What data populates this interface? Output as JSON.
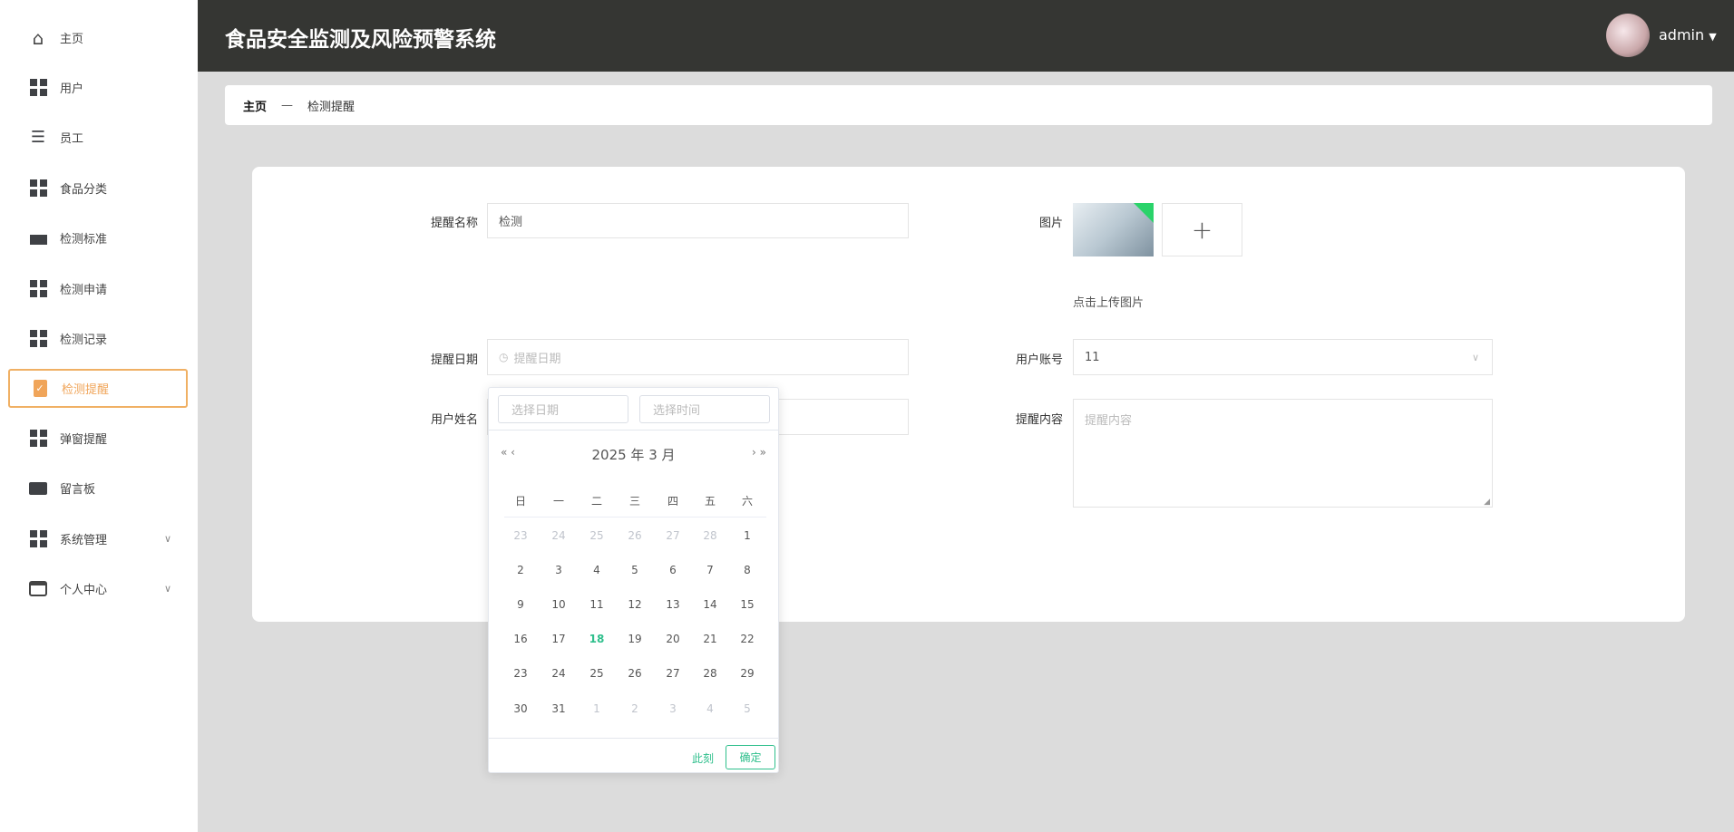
{
  "sidebar": {
    "items": [
      {
        "label": "主页",
        "icon": "home-icon"
      },
      {
        "label": "用户",
        "icon": "grid-icon"
      },
      {
        "label": "员工",
        "icon": "list-indent-icon"
      },
      {
        "label": "食品分类",
        "icon": "grid-icon"
      },
      {
        "label": "检测标准",
        "icon": "briefcase-icon"
      },
      {
        "label": "检测申请",
        "icon": "grid-icon"
      },
      {
        "label": "检测记录",
        "icon": "grid-icon"
      },
      {
        "label": "检测提醒",
        "icon": "clipboard-check-icon",
        "active": true
      },
      {
        "label": "弹窗提醒",
        "icon": "grid-icon"
      },
      {
        "label": "留言板",
        "icon": "ticket-icon"
      },
      {
        "label": "系统管理",
        "icon": "grid-icon",
        "expandable": true
      },
      {
        "label": "个人中心",
        "icon": "card-icon",
        "expandable": true
      }
    ]
  },
  "header": {
    "title": "食品安全监测及风险预警系统",
    "user": "admin"
  },
  "breadcrumb": {
    "home": "主页",
    "separator": "—",
    "current": "检测提醒"
  },
  "form": {
    "name_label": "提醒名称",
    "name_value": "检测",
    "image_label": "图片",
    "upload_hint": "点击上传图片",
    "upload_plus": "+",
    "date_label": "提醒日期",
    "date_placeholder": "提醒日期",
    "account_label": "用户账号",
    "account_value": "11",
    "username_label": "用户姓名",
    "content_label": "提醒内容",
    "content_placeholder": "提醒内容"
  },
  "datepicker": {
    "date_placeholder": "选择日期",
    "time_placeholder": "选择时间",
    "prev": "« ‹",
    "next": "› »",
    "month_title": "2025 年  3 月",
    "weekdays": [
      "日",
      "一",
      "二",
      "三",
      "四",
      "五",
      "六"
    ],
    "weeks": [
      [
        [
          "23",
          1
        ],
        [
          "24",
          1
        ],
        [
          "25",
          1
        ],
        [
          "26",
          1
        ],
        [
          "27",
          1
        ],
        [
          "28",
          1
        ],
        [
          "1",
          0
        ]
      ],
      [
        [
          "2",
          0
        ],
        [
          "3",
          0
        ],
        [
          "4",
          0
        ],
        [
          "5",
          0
        ],
        [
          "6",
          0
        ],
        [
          "7",
          0
        ],
        [
          "8",
          0
        ]
      ],
      [
        [
          "9",
          0
        ],
        [
          "10",
          0
        ],
        [
          "11",
          0
        ],
        [
          "12",
          0
        ],
        [
          "13",
          0
        ],
        [
          "14",
          0
        ],
        [
          "15",
          0
        ]
      ],
      [
        [
          "16",
          0
        ],
        [
          "17",
          0
        ],
        [
          "18",
          2
        ],
        [
          "19",
          0
        ],
        [
          "20",
          0
        ],
        [
          "21",
          0
        ],
        [
          "22",
          0
        ]
      ],
      [
        [
          "23",
          0
        ],
        [
          "24",
          0
        ],
        [
          "25",
          0
        ],
        [
          "26",
          0
        ],
        [
          "27",
          0
        ],
        [
          "28",
          0
        ],
        [
          "29",
          0
        ]
      ],
      [
        [
          "30",
          0
        ],
        [
          "31",
          0
        ],
        [
          "1",
          1
        ],
        [
          "2",
          1
        ],
        [
          "3",
          1
        ],
        [
          "4",
          1
        ],
        [
          "5",
          1
        ]
      ]
    ],
    "now_label": "此刻",
    "confirm_label": "确定"
  },
  "colors": {
    "accent": "#f0a55a",
    "green": "#2fbf8c",
    "header": "#353633"
  }
}
